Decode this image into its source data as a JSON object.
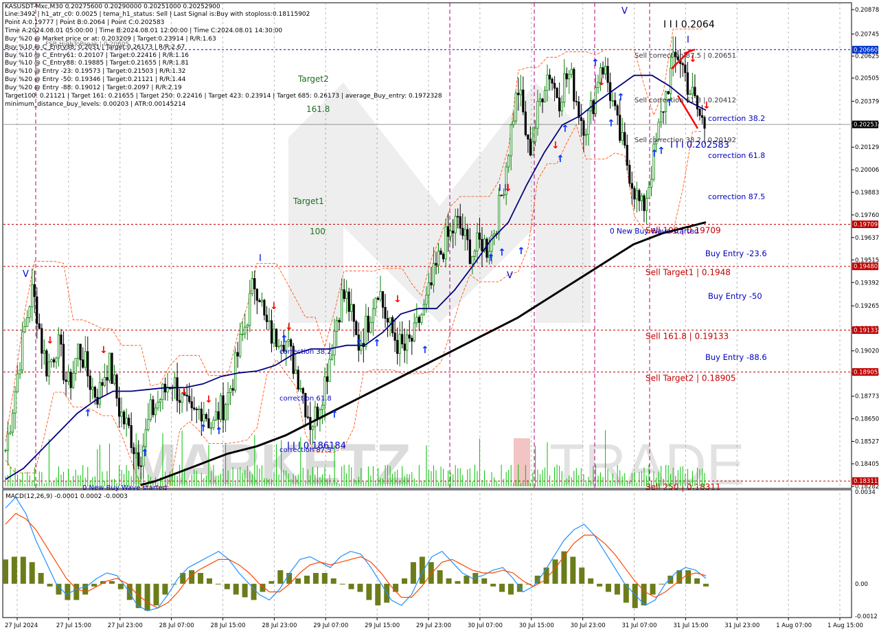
{
  "header": {
    "symbol_line": "KASUSDT-Mxc,M30  0.20275600 0.20290000 0.20251000 0.20252900",
    "info_lines": [
      "Line:3492 | h1_atr_c0: 0.0025 | tema_h1_status: Sell | Last Signal is:Buy with stoploss:0.18115902",
      "Point A:0.19777 | Point B:0.2064 | Point C:0.202583",
      "Time A:2024.08.01 05:00:00 | Time B:2024.08.01 12:00:00 | Time C:2024.08.01 14:30:00",
      "Buy %20 @ Market price or at: 0.203209 | Target:0.23914 | R/R:1.63",
      "Buy %10 @ C_Entry38: 0.2031 | Target:0.26173 | R/R:2.67",
      "Buy %10 @ C_Entry61: 0.20107 | Target:0.22416 | R/R:1.16",
      "Buy %10 @ C_Entry88: 0.19885 | Target:0.21655 | R/R:1.81",
      "Buy %10 @ Entry -23: 0.19573 | Target:0.21503 | R/R:1.32",
      "Buy %20 @ Entry -50: 0.19346 | Target:0.21121 | R/R:1.44",
      "Buy %20 @ Entry -88: 0.19012 | Target:0.2097 | R/R:2.19",
      "Target100: 0.21121 | Target 161: 0.21655 | Target 250: 0.22416 | Target 423: 0.23914 | Target 685: 0.26173 | average_Buy_entry: 0.1972328",
      "minimum_distance_buy_levels: 0.00203 | ATR:0.00145214"
    ],
    "fsb_label": "FSB-HighToBreak | 0.20605"
  },
  "chart_data": [
    {
      "type": "candlestick",
      "panel": "price",
      "symbol": "KASUSDT-Mxc",
      "timeframe": "M30",
      "ohlc_last": {
        "open": 0.202756,
        "high": 0.2029,
        "low": 0.20251,
        "close": 0.202529
      },
      "ylim": [
        0.18282,
        0.20878
      ],
      "y_ticks": [
        "0.20878",
        "0.20745",
        "0.20625",
        "0.20505",
        "0.20379",
        "0.20259",
        "0.20129",
        "0.20006",
        "0.19883",
        "0.19760",
        "0.19637",
        "0.19515",
        "0.19392",
        "0.19265",
        "0.19143",
        "0.19020",
        "0.18898",
        "0.18773",
        "0.18650",
        "0.18527",
        "0.18405",
        "0.18282"
      ],
      "x_ticks": [
        "27 Jul 2024",
        "27 Jul 15:00",
        "27 Jul 23:00",
        "28 Jul 07:00",
        "28 Jul 15:00",
        "28 Jul 23:00",
        "29 Jul 07:00",
        "29 Jul 15:00",
        "29 Jul 23:00",
        "30 Jul 07:00",
        "30 Jul 15:00",
        "30 Jul 23:00",
        "31 Jul 07:00",
        "31 Jul 15:00",
        "31 Jul 23:00",
        "1 Aug 07:00",
        "1 Aug 15:00"
      ],
      "close_path": [
        0.1848,
        0.1865,
        0.1883,
        0.1902,
        0.1918,
        0.1935,
        0.1925,
        0.1905,
        0.1893,
        0.1898,
        0.1907,
        0.1895,
        0.1882,
        0.189,
        0.1903,
        0.1898,
        0.1888,
        0.188,
        0.1878,
        0.1889,
        0.1895,
        0.1883,
        0.187,
        0.1863,
        0.1858,
        0.1848,
        0.1845,
        0.1855,
        0.1868,
        0.1872,
        0.1877,
        0.1881,
        0.1887,
        0.1882,
        0.1875,
        0.187,
        0.1865,
        0.1868,
        0.1872,
        0.1866,
        0.186,
        0.1868,
        0.1872,
        0.1878,
        0.1888,
        0.1902,
        0.1912,
        0.1926,
        0.194,
        0.1935,
        0.1918,
        0.1912,
        0.1908,
        0.1913,
        0.1908,
        0.19,
        0.1892,
        0.1885,
        0.1872,
        0.1862,
        0.1868,
        0.1878,
        0.189,
        0.1905,
        0.192,
        0.1932,
        0.193,
        0.1918,
        0.1905,
        0.191,
        0.1918,
        0.193,
        0.1938,
        0.1925,
        0.1915,
        0.191,
        0.1905,
        0.1902,
        0.1906,
        0.191,
        0.192,
        0.1925,
        0.1935,
        0.1945,
        0.1955,
        0.1962,
        0.1965,
        0.1972,
        0.1968,
        0.196,
        0.1955,
        0.1958,
        0.1962,
        0.1958,
        0.1965,
        0.1975,
        0.199,
        0.201,
        0.203,
        0.2045,
        0.203,
        0.201,
        0.202,
        0.2035,
        0.2048,
        0.2055,
        0.2045,
        0.204,
        0.205,
        0.2052,
        0.2042,
        0.203,
        0.2025,
        0.2032,
        0.2045,
        0.206,
        0.2052,
        0.204,
        0.2025,
        0.2015,
        0.2005,
        0.1995,
        0.1985,
        0.1978,
        0.199,
        0.2005,
        0.202,
        0.2035,
        0.2048,
        0.2058,
        0.2064,
        0.2055,
        0.2045,
        0.2038,
        0.203,
        0.2025
      ],
      "series": [
        {
          "name": "",
          "values": [
            0.1832,
            0.1838,
            0.1848,
            0.1858,
            0.1868,
            0.1875,
            0.188,
            0.188,
            0.1881,
            0.1882,
            0.1882,
            0.1884,
            0.1888,
            0.189,
            0.1891,
            0.1894,
            0.19,
            0.1903,
            0.1903,
            0.1905,
            0.1905,
            0.1912,
            0.1922,
            0.1925,
            0.1925,
            0.1935,
            0.1948,
            0.1962,
            0.1972,
            0.1992,
            0.201,
            0.2025,
            0.203,
            0.2038,
            0.2045,
            0.2052,
            0.2052,
            0.2046,
            0.2038,
            0.2033
          ]
        },
        {
          "name": "",
          "values": [
            0.1829,
            0.1831,
            0.1834,
            0.1837,
            0.184,
            0.1843,
            0.1846,
            0.1848,
            0.185,
            0.1853,
            0.1856,
            0.186,
            0.1864,
            0.1868,
            0.1872,
            0.1876,
            0.188,
            0.1884,
            0.1888,
            0.1892,
            0.1896,
            0.19,
            0.1904,
            0.1908,
            0.1912,
            0.1916,
            0.192,
            0.1925,
            0.193,
            0.1935,
            0.194,
            0.1945,
            0.195,
            0.1955,
            0.196,
            0.1963,
            0.1966,
            0.1968,
            0.197,
            0.1972
          ]
        }
      ],
      "horizontal_levels": [
        {
          "label": "Sell 100 | 0.19709",
          "value": 0.19709,
          "color": "#c00000"
        },
        {
          "label": "Sell Target1 | 0.1948",
          "value": 0.1948,
          "color": "#c00000"
        },
        {
          "label": "Sell 161.8 | 0.19133",
          "value": 0.19133,
          "color": "#c00000"
        },
        {
          "label": "Sell Target2 | 0.18905",
          "value": 0.18905,
          "color": "#c00000"
        },
        {
          "label": "Sell 250 | 0.18311",
          "value": 0.18311,
          "color": "#c00000"
        },
        {
          "label": "FSB-HighToBreak | 0.20605",
          "value": 0.2066,
          "color": "#0000c0"
        }
      ],
      "axis_badges": [
        {
          "text": "0.20660",
          "value": 0.2066,
          "color": "#0033cc"
        },
        {
          "text": "0.20253",
          "value": 0.20253,
          "color": "#000000"
        },
        {
          "text": "0.19709",
          "value": 0.19709,
          "color": "#c00000"
        },
        {
          "text": "0.19480",
          "value": 0.1948,
          "color": "#c00000"
        },
        {
          "text": "0.19133",
          "value": 0.19133,
          "color": "#c00000"
        },
        {
          "text": "0.18905",
          "value": 0.18905,
          "color": "#c00000"
        },
        {
          "text": "0.18311",
          "value": 0.18311,
          "color": "#c00000"
        }
      ],
      "annotations": {
        "wave_top": "I I I 0.2064",
        "wave_c": "I I I 0.202583",
        "wave_low": "I I I 0.186184",
        "sell_correction_87": "Sell correction 87.5 | 0.20651",
        "sell_correction_61": "Sell correction 61.8 | 0.20412",
        "sell_correction_38": "Sell correction 38.2 | 0.20192",
        "correction_38_right": "correction 38.2",
        "correction_61_right": "correction 61.8",
        "correction_87_right": "correction 87.5",
        "new_buy_wave_1": "0 New Buy Wave started",
        "new_buy_wave_2": "0 New Buy Wave started",
        "buy_entry_23": "Buy Entry -23.6",
        "buy_entry_50": "Buy Entry -50",
        "buy_entry_88": "Buy Entry -88.6",
        "target2": "Target2",
        "target2_pct": "161.8",
        "target1": "Target1",
        "target1_pct": "100",
        "correction_38_mid": "correction 38.2",
        "correction_61_mid": "correction 61.8",
        "correction_87_mid": "correction 87.5",
        "wave_mark_v": "V",
        "wave_mark_i": "I",
        "wave_mark_ii": "I I",
        "wave_mark_v2": "V"
      }
    },
    {
      "type": "bar",
      "panel": "indicator",
      "title": "MACD(12,26,9) -0.0001 0.0002 -0.0003",
      "ylim": [
        -0.0012,
        0.0034
      ],
      "y_ticks": [
        "0.0034",
        "0.00",
        "-0.0012"
      ],
      "histogram": [
        0.0009,
        0.001,
        0.001,
        0.0008,
        0.0004,
        -0.0001,
        -0.0004,
        -0.0006,
        -0.0006,
        -0.0004,
        -0.0001,
        0.0001,
        0.0001,
        -0.0002,
        -0.0006,
        -0.0009,
        -0.001,
        -0.0008,
        -0.0004,
        0.0,
        0.0004,
        0.0005,
        0.0004,
        0.0002,
        0.0,
        -0.0002,
        -0.0004,
        -0.0005,
        -0.0006,
        -0.0003,
        0.0001,
        0.0005,
        0.0004,
        0.0002,
        0.0003,
        0.0004,
        0.0004,
        0.0002,
        0.0,
        -0.0002,
        -0.0003,
        -0.0006,
        -0.0008,
        -0.0007,
        -0.0003,
        0.0002,
        0.0008,
        0.001,
        0.0008,
        0.0005,
        0.0002,
        0.0001,
        0.0003,
        0.0004,
        0.0002,
        -0.0001,
        -0.0003,
        -0.0004,
        -0.0003,
        0.0,
        0.0003,
        0.0006,
        0.0009,
        0.0012,
        0.001,
        0.0006,
        0.0002,
        -0.0001,
        -0.0003,
        -0.0004,
        -0.0007,
        -0.0009,
        -0.0008,
        -0.0004,
        0.0,
        0.0003,
        0.0005,
        0.0005,
        0.0002,
        -0.0001
      ],
      "series": [
        {
          "name": "",
          "values": [
            0.0028,
            0.0032,
            0.0026,
            0.0016,
            0.0008,
            0.0,
            -0.0004,
            -0.0002,
            -0.0001,
            0.0002,
            0.0004,
            0.0003,
            -0.0002,
            -0.0008,
            -0.001,
            -0.0009,
            -0.0004,
            0.0002,
            0.0006,
            0.0008,
            0.001,
            0.0012,
            0.0009,
            0.0004,
            0.0,
            -0.0004,
            -0.0006,
            -0.0002,
            0.0004,
            0.0009,
            0.001,
            0.0008,
            0.0006,
            0.001,
            0.0012,
            0.0011,
            0.0006,
            0.0,
            -0.0006,
            -0.0008,
            -0.0004,
            0.0004,
            0.001,
            0.0012,
            0.0008,
            0.0004,
            0.0002,
            0.0003,
            0.0005,
            0.0006,
            0.0002,
            -0.0003,
            -0.0001,
            0.0004,
            0.001,
            0.0016,
            0.002,
            0.0022,
            0.0018,
            0.0012,
            0.0006,
            0.0,
            -0.0004,
            -0.0008,
            -0.0006,
            0.0,
            0.0004,
            0.0006,
            0.0005,
            0.0002
          ]
        },
        {
          "name": "",
          "values": [
            0.0022,
            0.0026,
            0.0024,
            0.002,
            0.0014,
            0.0008,
            0.0002,
            -0.0002,
            -0.0003,
            -0.0001,
            0.0001,
            0.0002,
            0.0,
            -0.0004,
            -0.0007,
            -0.0009,
            -0.0007,
            -0.0003,
            0.0002,
            0.0005,
            0.0007,
            0.0009,
            0.0009,
            0.0007,
            0.0004,
            0.0,
            -0.0003,
            -0.0003,
            0.0,
            0.0004,
            0.0007,
            0.0008,
            0.0007,
            0.0008,
            0.0009,
            0.001,
            0.0008,
            0.0004,
            -0.0001,
            -0.0005,
            -0.0005,
            -0.0001,
            0.0004,
            0.0008,
            0.0009,
            0.0007,
            0.0005,
            0.0004,
            0.0004,
            0.0005,
            0.0004,
            0.0001,
            -0.0001,
            0.0001,
            0.0005,
            0.001,
            0.0015,
            0.0018,
            0.0018,
            0.0015,
            0.0011,
            0.0006,
            0.0001,
            -0.0003,
            -0.0005,
            -0.0003,
            0.0,
            0.0003,
            0.0004,
            0.0003
          ]
        }
      ]
    }
  ],
  "colors": {
    "bull_candle": "#008000",
    "bear_candle": "#000000",
    "ema_fast": "#000080",
    "ema_slow": "#000000",
    "envelope": "#ff4500",
    "level_red": "#c00000",
    "level_blue": "#0000c0",
    "buy_arrow": "#0033ff",
    "sell_arrow": "#ff0000",
    "volume": "#00c000",
    "macd_hist": "#6b7d1a",
    "macd_main": "#1e90ff",
    "macd_signal": "#ff4500",
    "vline_magenta": "#b0007a",
    "watermark": "#d8d8d8",
    "watermark_red": "#f0b0b0"
  },
  "watermark": {
    "left": "MARKETZ",
    "right": "TRADE"
  }
}
